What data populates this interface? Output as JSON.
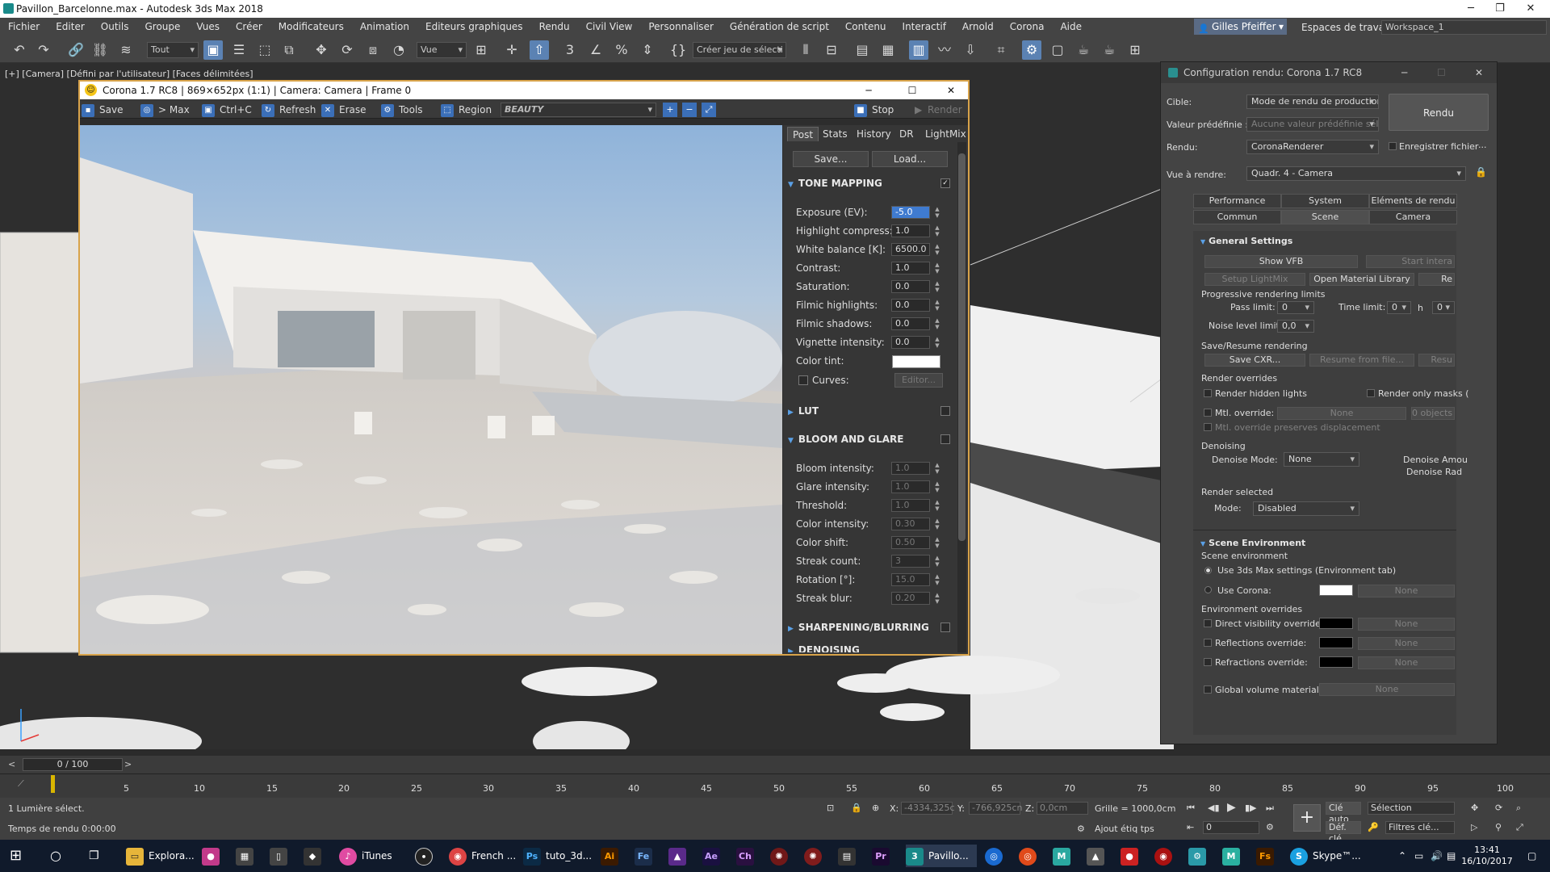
{
  "app": {
    "title": "Pavillon_Barcelonne.max - Autodesk 3ds Max 2018"
  },
  "menu": [
    "Fichier",
    "Editer",
    "Outils",
    "Groupe",
    "Vues",
    "Créer",
    "Modificateurs",
    "Animation",
    "Editeurs graphiques",
    "Rendu",
    "Civil View",
    "Personnaliser",
    "Génération de script",
    "Contenu",
    "Interactif",
    "Arnold",
    "Corona",
    "Aide"
  ],
  "user": {
    "name": "Gilles Pfeiffer",
    "workspace_label": "Espaces de travail:",
    "workspace": "Workspace_1"
  },
  "toolbar": {
    "filter": "Tout",
    "ref_coord": "Vue",
    "selection_set": "Créer jeu de sélecti"
  },
  "viewport": {
    "label": "[+] [Camera] [Défini par l'utilisateur] [Faces délimitées]"
  },
  "vfb": {
    "title": "Corona 1.7 RC8 | 869×652px (1:1) | Camera: Camera | Frame 0",
    "tools": {
      "save": "Save",
      "max": "> Max",
      "copy": "Ctrl+C",
      "refresh": "Refresh",
      "erase": "Erase",
      "tools": "Tools",
      "region": "Region",
      "channel": "BEAUTY",
      "stop": "Stop",
      "render": "Render"
    },
    "tabs": [
      "Post",
      "Stats",
      "History",
      "DR",
      "LightMix"
    ],
    "save_btn": "Save...",
    "load_btn": "Load...",
    "sections": {
      "tone_mapping": "TONE MAPPING",
      "lut": "LUT",
      "bloom": "BLOOM AND GLARE",
      "sharpen": "SHARPENING/BLURRING",
      "denoising": "DENOISING"
    },
    "tone": [
      {
        "label": "Exposure (EV):",
        "value": "-5.0"
      },
      {
        "label": "Highlight compress:",
        "value": "1.0"
      },
      {
        "label": "White balance [K]:",
        "value": "6500.0"
      },
      {
        "label": "Contrast:",
        "value": "1.0"
      },
      {
        "label": "Saturation:",
        "value": "0.0"
      },
      {
        "label": "Filmic highlights:",
        "value": "0.0"
      },
      {
        "label": "Filmic shadows:",
        "value": "0.0"
      },
      {
        "label": "Vignette intensity:",
        "value": "0.0"
      }
    ],
    "color_tint_label": "Color tint:",
    "curves_label": "Curves:",
    "curves_btn": "Editor...",
    "bloom": [
      {
        "label": "Bloom intensity:",
        "value": "1.0"
      },
      {
        "label": "Glare intensity:",
        "value": "1.0"
      },
      {
        "label": "Threshold:",
        "value": "1.0"
      },
      {
        "label": "Color intensity:",
        "value": "0.30"
      },
      {
        "label": "Color shift:",
        "value": "0.50"
      },
      {
        "label": "Streak count:",
        "value": "3"
      },
      {
        "label": "Rotation [°]:",
        "value": "15.0"
      },
      {
        "label": "Streak blur:",
        "value": "0.20"
      }
    ]
  },
  "rs": {
    "title": "Configuration rendu: Corona 1.7 RC8",
    "target_label": "Cible:",
    "target": "Mode de rendu de production",
    "preset_label": "Valeur prédéfinie :",
    "preset": "Aucune valeur prédéfinie sélect",
    "renderer_label": "Rendu:",
    "renderer": "CoronaRenderer",
    "save_file": "Enregistrer fichier",
    "view_label": "Vue à rendre:",
    "view": "Quadr. 4 - Camera",
    "render_btn": "Rendu",
    "tabs_row1": [
      "Performance",
      "System",
      "Eléments de rendu"
    ],
    "tabs_row2": [
      "Commun",
      "Scene",
      "Camera"
    ],
    "general": "General Settings",
    "show_vfb": "Show VFB",
    "start_inter": "Start intera",
    "setup_lightmix": "Setup LightMix",
    "open_mat": "Open Material Library",
    "re": "Re",
    "prog_label": "Progressive rendering limits",
    "pass_label": "Pass limit:",
    "pass_val": "0",
    "time_label": "Time limit:",
    "time_val": "0",
    "h": "h",
    "time_min": "0",
    "noise_label": "Noise level limit:",
    "noise_val": "0,0",
    "save_resume": "Save/Resume rendering",
    "save_cxr": "Save CXR...",
    "resume_file": "Resume from file...",
    "resu": "Resu",
    "overrides": "Render overrides",
    "hidden_lights": "Render hidden lights",
    "only_masks": "Render only masks (",
    "mtl_label": "Mtl. override:",
    "mtl_none": "None",
    "mtl_objs": "0 objects",
    "mtl_disp": "Mtl. override preserves displacement",
    "denoising": "Denoising",
    "denoise_mode_label": "Denoise Mode:",
    "denoise_mode": "None",
    "denoise_amount": "Denoise Amou",
    "denoise_radius": "Denoise Rad",
    "render_selected": "Render selected",
    "mode_label": "Mode:",
    "mode": "Disabled",
    "scene_env": "Scene Environment",
    "scene_env_label": "Scene environment",
    "use_max": "Use 3ds Max settings (Environment tab)",
    "use_corona": "Use Corona:",
    "none": "None",
    "env_overrides": "Environment overrides",
    "direct": "Direct visibility override:",
    "reflections": "Reflections override:",
    "refractions": "Refractions override:",
    "global_vol": "Global volume material:"
  },
  "timeline": {
    "frame": "0 / 100",
    "ticks": [
      "5",
      "10",
      "15",
      "20",
      "25",
      "30",
      "35",
      "40",
      "45",
      "50",
      "55",
      "60",
      "65",
      "70",
      "75",
      "80",
      "85",
      "90",
      "95",
      "100"
    ],
    "start": "0"
  },
  "status": {
    "selected": "1 Lumière sélect.",
    "render_time": "Temps de rendu 0:00:00",
    "x_label": "X:",
    "x": "-4334,325c",
    "y_label": "Y:",
    "y": "-766,925cn",
    "z_label": "Z:",
    "z": "0,0cm",
    "grid": "Grille = 1000,0cm",
    "add_tag": "Ajout étiq tps",
    "auto_key": "Clé auto",
    "selection": "Sélection",
    "set_key": "Déf. clé",
    "filters": "Filtres clé...",
    "frame": "0"
  },
  "taskbar": {
    "apps": [
      "Explora...",
      "iTunes",
      "French ...",
      "tuto_3d...",
      "Pavillo...",
      "Skype™..."
    ],
    "time": "13:41",
    "date": "16/10/2017"
  }
}
